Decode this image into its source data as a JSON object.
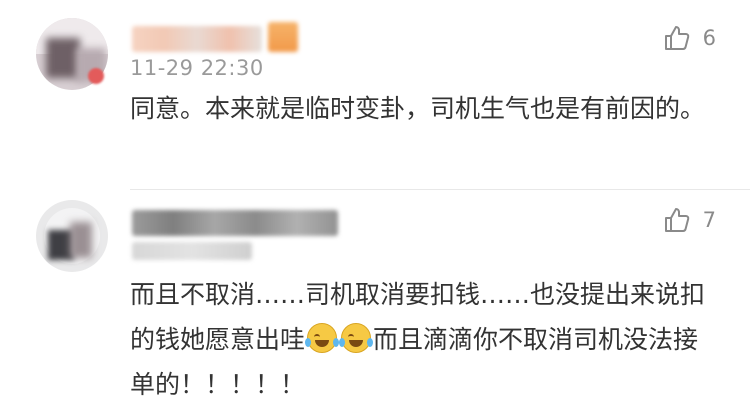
{
  "comments": [
    {
      "time": "11-29 22:30",
      "likes": "6",
      "text": "同意。本来就是临时变卦，司机生气也是有前因的。"
    },
    {
      "likes": "7",
      "text_a": "而且不取消……司机取消要扣钱……也没提出来说扣的钱她愿意出哇",
      "text_b": "而且滴滴你不取消司机没法接单的！！！！！"
    }
  ],
  "icons": {
    "like": "thumbs-up-icon",
    "emoji": "crying-laughing-emoji"
  },
  "colors": {
    "time": "#9a9a9a",
    "body": "#333333",
    "icon": "#8a8a8a"
  }
}
